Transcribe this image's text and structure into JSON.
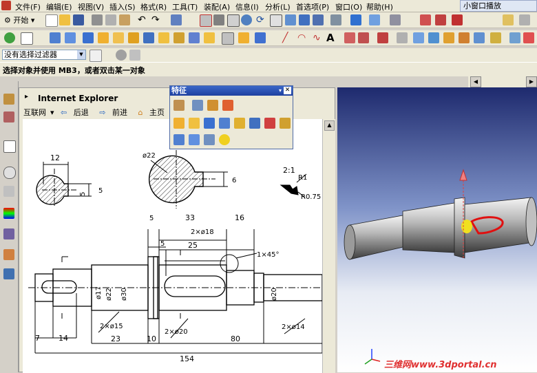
{
  "menubar": {
    "items": [
      "文件(F)",
      "编辑(E)",
      "视图(V)",
      "插入(S)",
      "格式(R)",
      "工具(T)",
      "装配(A)",
      "信息(I)",
      "分析(L)",
      "首选项(P)",
      "窗口(O)",
      "帮助(H)"
    ],
    "mini_window": "小窗口播放"
  },
  "toolbar": {
    "start_label": "开始"
  },
  "filter": {
    "value": "没有选择过滤器"
  },
  "cue": {
    "text": "选择对象并使用 MB3，或者双击某一对象"
  },
  "ie": {
    "title": "Internet Explorer",
    "nav": {
      "internet": "互联网",
      "back": "后退",
      "forward": "前进",
      "home": "主页"
    }
  },
  "feature_palette": {
    "title": "特征"
  },
  "drawing": {
    "dims": {
      "d12": "12",
      "d5_top": "5",
      "d22_dia": "ø22",
      "d6": "6",
      "scale": "2:1",
      "r1": "R1",
      "r075": "R0.75",
      "d5a": "5",
      "d33": "33",
      "d16": "16",
      "d2xd18": "2×ø18",
      "d5b": "5",
      "d25": "25",
      "chamfer": "1×45°",
      "d17": "ø17",
      "d22": "ø22",
      "d30": "ø30",
      "d20": "ø20",
      "d7": "7",
      "d14": "14",
      "d2xd15": "2×ø15",
      "d2xd20": "2×ø20",
      "d2xd14": "2×ø14",
      "d23": "23",
      "d10": "10",
      "d80": "80",
      "d154": "154"
    }
  },
  "watermark": {
    "text": "三维网www.3dportal.cn"
  },
  "colors": {
    "menubar": "#ece9d8",
    "title_blue": "#1e40a0",
    "watermark": "#e03030"
  }
}
